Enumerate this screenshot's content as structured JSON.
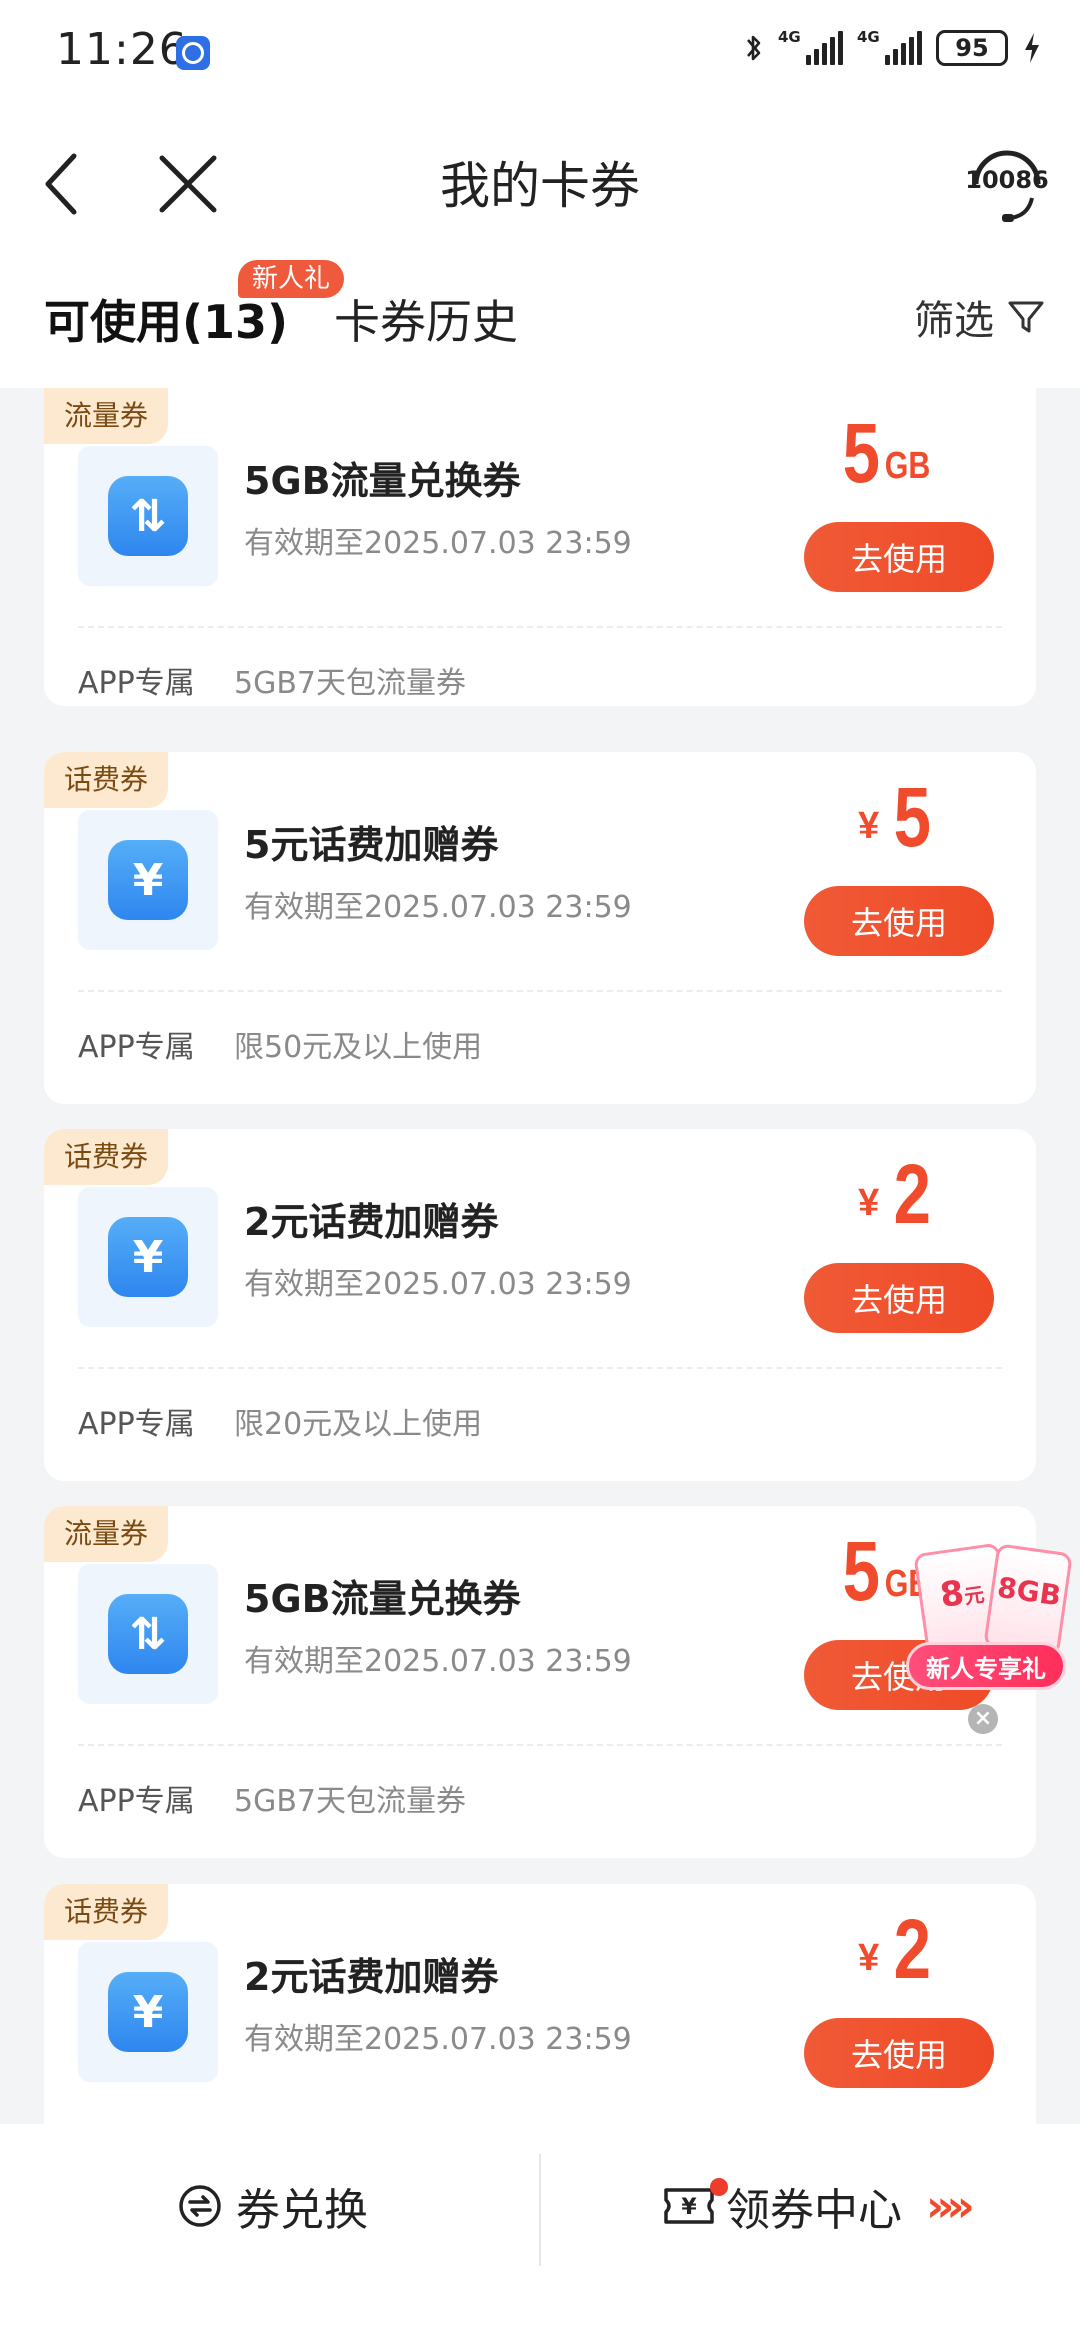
{
  "status_bar": {
    "time": "11:26",
    "signal1_label": "4G",
    "signal2_label": "4G",
    "battery": "95",
    "icons": [
      "bluetooth-icon",
      "signal-icon",
      "battery-icon",
      "charging-icon"
    ]
  },
  "header": {
    "title": "我的卡券",
    "service_number": "10086"
  },
  "tabs": {
    "available": "可使用(13)",
    "new_badge": "新人礼",
    "history": "卡券历史",
    "filter": "筛选"
  },
  "coupons": [
    {
      "tag": "流量券",
      "title": "5GB流量兑换券",
      "expire": "有效期至2025.07.03 23:59",
      "currency": "",
      "amount": "5",
      "unit": "GB",
      "button": "去使用",
      "scope": "APP专属",
      "condition": "5GB7天包流量券",
      "icon": "data-transfer-icon",
      "icon_glyph": "⇅"
    },
    {
      "tag": "话费券",
      "title": "5元话费加赠券",
      "expire": "有效期至2025.07.03 23:59",
      "currency": "¥",
      "amount": "5",
      "unit": "",
      "button": "去使用",
      "scope": "APP专属",
      "condition": "限50元及以上使用",
      "icon": "yuan-icon",
      "icon_glyph": "¥"
    },
    {
      "tag": "话费券",
      "title": "2元话费加赠券",
      "expire": "有效期至2025.07.03 23:59",
      "currency": "¥",
      "amount": "2",
      "unit": "",
      "button": "去使用",
      "scope": "APP专属",
      "condition": "限20元及以上使用",
      "icon": "yuan-icon",
      "icon_glyph": "¥"
    },
    {
      "tag": "流量券",
      "title": "5GB流量兑换券",
      "expire": "有效期至2025.07.03 23:59",
      "currency": "",
      "amount": "5",
      "unit": "GB",
      "button": "去使用",
      "scope": "APP专属",
      "condition": "5GB7天包流量券",
      "icon": "data-transfer-icon",
      "icon_glyph": "⇅"
    },
    {
      "tag": "话费券",
      "title": "2元话费加赠券",
      "expire": "有效期至2025.07.03 23:59",
      "currency": "¥",
      "amount": "2",
      "unit": "",
      "button": "去使用",
      "scope": "",
      "condition": "",
      "icon": "yuan-icon",
      "icon_glyph": "¥"
    }
  ],
  "gift": {
    "card1_amount": "8",
    "card1_unit": "元",
    "card2_text": "8GB",
    "ribbon": "新人专享礼",
    "close": "×"
  },
  "bottom_bar": {
    "exchange": "券兑换",
    "center": "领券中心",
    "center_arrows": "»»"
  },
  "colors": {
    "accent": "#ef4b2c",
    "tag_bg": "#fde9cf",
    "icon_blue": "#2e86ef"
  }
}
